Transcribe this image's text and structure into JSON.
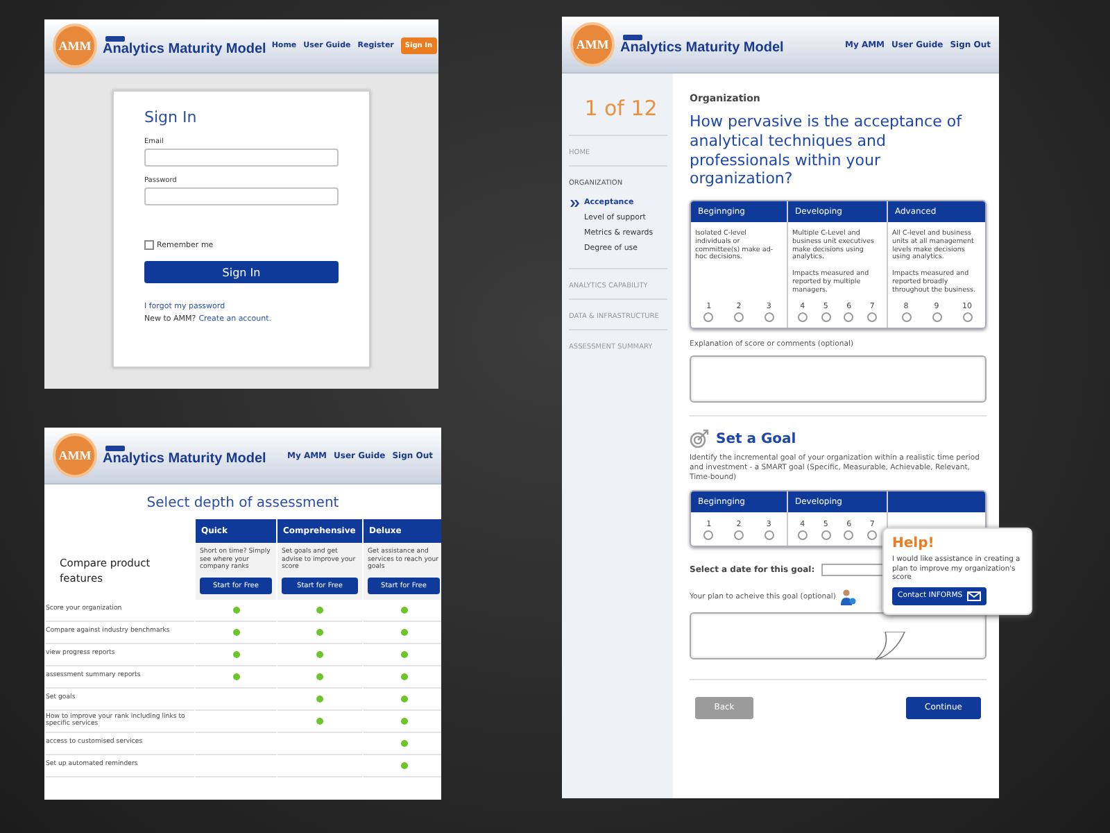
{
  "sign_in_screen": {
    "header": {
      "logo": "AMM",
      "title": "Analytics Maturity Model",
      "nav": [
        {
          "label": "Home",
          "kind": "link"
        },
        {
          "label": "User Guide",
          "kind": "link"
        },
        {
          "label": "Register",
          "kind": "link"
        },
        {
          "label": "Sign In",
          "kind": "button"
        }
      ]
    },
    "card": {
      "title": "Sign In",
      "fields": [
        {
          "label": "Email"
        },
        {
          "label": "Password"
        }
      ],
      "remember": {
        "label": "Remember me",
        "checked": false
      },
      "button": "Sign In",
      "forgot": "I forgot my password",
      "new_prompt": "New to AMM?",
      "create_link": "Create an account."
    }
  },
  "pricing_screen": {
    "header": {
      "logo": "AMM",
      "title": "Analytics Maturity Model",
      "nav": [
        {
          "label": "My AMM",
          "kind": "link"
        },
        {
          "label": "User Guide",
          "kind": "link"
        },
        {
          "label": "Sign Out",
          "kind": "link"
        }
      ]
    },
    "title": "Select depth of assessment",
    "compare_label": "Compare product features",
    "plans": [
      {
        "name": "Quick",
        "description": "Short on time? Simply see  where your company ranks",
        "button": "Start for Free"
      },
      {
        "name": "Comprehensive",
        "description": "Set goals and get advise to improve your score",
        "button": "Start for Free"
      },
      {
        "name": "Deluxe",
        "description": "Get assistance and services to reach your goals",
        "button": "Start for Free"
      }
    ],
    "features": [
      {
        "label": "Score your organization",
        "included": [
          true,
          true,
          true
        ]
      },
      {
        "label": "Compare against industry benchmarks",
        "included": [
          true,
          true,
          true
        ]
      },
      {
        "label": "view progress reports",
        "included": [
          true,
          true,
          true
        ]
      },
      {
        "label": "assessment summary reports",
        "included": [
          true,
          true,
          true
        ]
      },
      {
        "label": "Set goals",
        "included": [
          false,
          true,
          true
        ]
      },
      {
        "label": "How to improve your rank including links to specific services",
        "included": [
          false,
          true,
          true
        ]
      },
      {
        "label": "access to customised services",
        "included": [
          false,
          false,
          true
        ]
      },
      {
        "label": "Set up automated reminders",
        "included": [
          false,
          false,
          true
        ]
      }
    ]
  },
  "assessment_screen": {
    "header": {
      "logo": "AMM",
      "title": "Analytics Maturity Model",
      "nav": [
        {
          "label": "My AMM",
          "kind": "link"
        },
        {
          "label": "User Guide",
          "kind": "link"
        },
        {
          "label": "Sign Out",
          "kind": "link"
        }
      ]
    },
    "progress": "1 of 12",
    "sidebar": [
      {
        "label": "HOME",
        "expanded": false
      },
      {
        "label": "ORGANIZATION",
        "expanded": true,
        "children": [
          {
            "label": "Acceptance",
            "selected": true
          },
          {
            "label": "Level of support",
            "selected": false
          },
          {
            "label": "Metrics & rewards",
            "selected": false
          },
          {
            "label": "Degree of use",
            "selected": false
          }
        ]
      },
      {
        "label": "ANALYTICS CAPABILITY",
        "expanded": false
      },
      {
        "label": "DATA & INFRASTRUCTURE",
        "expanded": false
      },
      {
        "label": "ASSESSMENT SUMMARY",
        "expanded": false
      }
    ],
    "section": "Organization",
    "question": "How pervasive is the acceptance of analytical techniques and professionals within your organization?",
    "levels": [
      {
        "name": "Beginnging",
        "descriptions": [
          "Isolated C-level individuals or committee(s) make ad-hoc decisions."
        ],
        "scores": [
          {
            "label": "1",
            "selected": false
          },
          {
            "label": "2",
            "selected": false
          },
          {
            "label": "3",
            "selected": false
          }
        ]
      },
      {
        "name": "Developing",
        "descriptions": [
          "Multiple C-Level and business unit executives make decisions using analytics.",
          "Impacts measured and reported by multiple managers."
        ],
        "scores": [
          {
            "label": "4",
            "selected": false
          },
          {
            "label": "5",
            "selected": false
          },
          {
            "label": "6",
            "selected": false
          },
          {
            "label": "7",
            "selected": false
          }
        ]
      },
      {
        "name": "Advanced",
        "descriptions": [
          "All C-level and business units at all management levels make decisions using analytics.",
          "Impacts measured and reported broadly throughout the business."
        ],
        "scores": [
          {
            "label": "8",
            "selected": false
          },
          {
            "label": "9",
            "selected": false
          },
          {
            "label": "10",
            "selected": false
          }
        ]
      }
    ],
    "comment_label": "Explanation of score or comments (optional)",
    "goal": {
      "title": "Set a Goal",
      "description": "Identify the incremental goal of your organization within a realistic time period and investment - a SMART goal (Specific, Measurable, Achievable, Relevant, Time-bound)",
      "levels": [
        {
          "name": "Beginnging",
          "scores": [
            {
              "label": "1",
              "selected": false
            },
            {
              "label": "2",
              "selected": false
            },
            {
              "label": "3",
              "selected": false
            }
          ]
        },
        {
          "name": "Developing",
          "scores": [
            {
              "label": "4",
              "selected": false
            },
            {
              "label": "5",
              "selected": false
            },
            {
              "label": "6",
              "selected": false
            },
            {
              "label": "7",
              "selected": false
            }
          ]
        }
      ],
      "date_label": "Select a date for this goal:",
      "plan_label": "Your plan to acheive this goal (optional)"
    },
    "buttons": [
      {
        "label": "Back",
        "kind": "secondary"
      },
      {
        "label": "Continue",
        "kind": "primary"
      }
    ],
    "help": {
      "title": "Help!",
      "text": "I would like assistance in creating a plan to improve my organization's score",
      "button": "Contact INFORMS"
    }
  }
}
